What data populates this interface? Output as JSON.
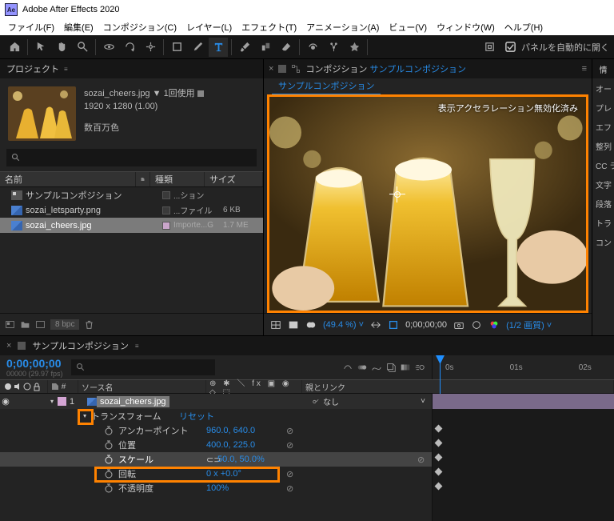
{
  "app": {
    "title": "Adobe After Effects 2020",
    "logo": "Ae"
  },
  "menu": {
    "file": "ファイル(F)",
    "edit": "編集(E)",
    "comp": "コンポジション(C)",
    "layer": "レイヤー(L)",
    "effect": "エフェクト(T)",
    "anim": "アニメーション(A)",
    "view": "ビュー(V)",
    "window": "ウィンドウ(W)",
    "help": "ヘルプ(H)"
  },
  "toolbar": {
    "autopanel": "パネルを自動的に開く"
  },
  "project": {
    "title": "プロジェクト",
    "asset_name": "sozai_cheers.jpg",
    "asset_used": "1回使用",
    "asset_dim": "1920 x 1280 (1.00)",
    "asset_colors": "数百万色",
    "search_placeholder": "",
    "cols": {
      "name": "名前",
      "type": "種類",
      "size": "サイズ"
    },
    "rows": [
      {
        "name": "サンプルコンポジション",
        "type": "...ション",
        "size": ""
      },
      {
        "name": "sozai_letsparty.png",
        "type": "...ファイル",
        "size": "6 KB"
      },
      {
        "name": "sozai_cheers.jpg",
        "type": "Importe...G",
        "size": "1.7 ME"
      }
    ],
    "footer_bpc": "8 bpc"
  },
  "viewer": {
    "panel_label": "コンポジション",
    "comp_name": "サンプルコンポジション",
    "tab": "サンプルコンポジション",
    "accel_text": "表示アクセラレーション無効化済み",
    "zoom": "(49.4 %)",
    "time": "0;00;00;00",
    "quality": "(1/2 画質)"
  },
  "sidepanels": {
    "info": "情",
    "audio": "オー",
    "preview": "プレ",
    "effects": "エフ",
    "align": "整列",
    "cc": "CC ラ",
    "char": "文字",
    "para": "段落",
    "tracker": "トラ",
    "content": "コン"
  },
  "timeline": {
    "tab": "サンプルコンポジション",
    "timecode": "0;00;00;00",
    "fps": "00000 (29.97 fps)",
    "ruler": {
      "t0": "0s",
      "t1": "01s",
      "t2": "02s"
    },
    "cols": {
      "num": "#",
      "source": "ソース名",
      "switches": "☀☆＼fx",
      "parent": "親とリンク"
    },
    "layer": {
      "num": "1",
      "name": "sozai_cheers.jpg",
      "parent": "なし"
    },
    "transform": {
      "label": "トランスフォーム",
      "reset": "リセット"
    },
    "props": {
      "anchor": {
        "name": "アンカーポイント",
        "val": "960.0, 640.0"
      },
      "position": {
        "name": "位置",
        "val": "400.0, 225.0"
      },
      "scale": {
        "name": "スケール",
        "val": "50.0, 50.0",
        "unit": "%"
      },
      "rotation": {
        "name": "回転",
        "val": "0 x +0.0",
        "deg": "°"
      },
      "opacity": {
        "name": "不透明度",
        "val": "100",
        "unit": "%"
      }
    }
  }
}
